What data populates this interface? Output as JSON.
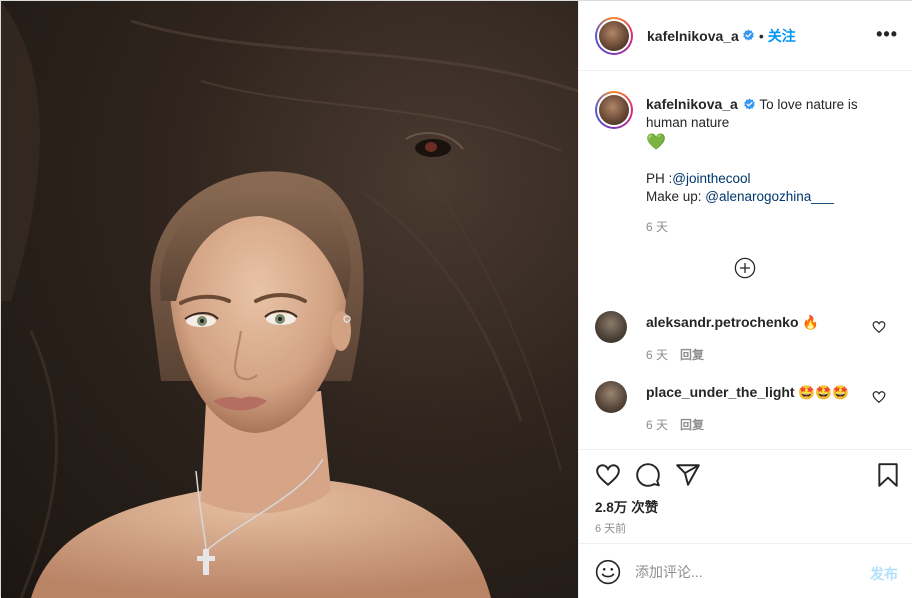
{
  "post": {
    "username": "kafelnikova_a",
    "separator": "•",
    "follow_label": "关注",
    "more_label": "•••",
    "caption": {
      "line1": "To love nature is human nature",
      "emoji": "💚",
      "ph_prefix": "PH :",
      "ph_handle": "@jointhecool",
      "makeup_prefix": "Make up: ",
      "makeup_handle": "@alenarogozhina___",
      "time": "6 天"
    },
    "comments": [
      {
        "username": "aleksandr.petrochenko",
        "text": "🔥",
        "time": "6 天",
        "reply_label": "回复"
      },
      {
        "username": "place_under_the_light",
        "text": "🤩🤩🤩",
        "time": "6 天",
        "reply_label": "回复"
      }
    ],
    "likes_count": "2.8万",
    "likes_label": "次赞",
    "posted_time": "6 天前",
    "comment_placeholder": "添加评论...",
    "post_button_label": "发布"
  },
  "colors": {
    "accent": "#0095f6",
    "link": "#00376b",
    "muted": "#8e8e8e",
    "post_disabled": "#b2dffc",
    "verified": "#3897f0"
  },
  "icons": [
    "verified-badge-icon",
    "more-options-icon",
    "load-more-icon",
    "heart-icon",
    "comment-icon",
    "share-icon",
    "bookmark-icon",
    "emoji-icon"
  ]
}
